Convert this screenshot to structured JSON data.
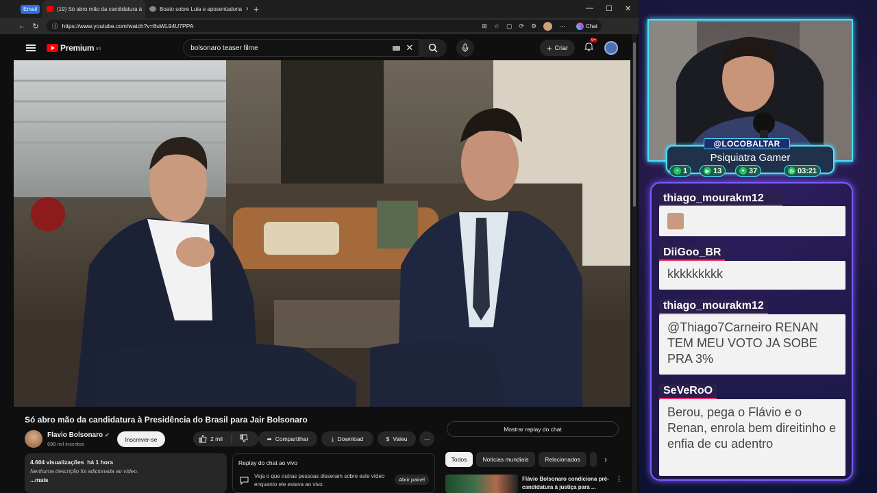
{
  "browser": {
    "tab_badge": "Email",
    "tabs": [
      {
        "label": "(19) Só abro mão da candidatura à",
        "active": true
      },
      {
        "label": "Boato sobre Lula e aposentadoria",
        "active": false
      }
    ],
    "url": "https://www.youtube.com/watch?v=8uWL94U7PPA",
    "chat_button": "Chat"
  },
  "youtube": {
    "logo_text": "Premium",
    "logo_region": "BR",
    "search_value": "bolsonaro teaser filme",
    "create_label": "Criar",
    "notification_count": "9+",
    "video_title": "Só abro mão da candidatura à Presidência do Brasil para Jair Bolsonaro",
    "channel_name": "Flavio Bolsonaro",
    "channel_subs": "698 mil inscritos",
    "subscribe_label": "Inscrever-se",
    "like_count": "2 mil",
    "share_label": "Compartilhar",
    "download_label": "Download",
    "thanks_label": "Valeu",
    "views": "4.604 visualizações",
    "posted": "há 1 hora",
    "description_empty": "Nenhuma descrição foi adicionada ao vídeo.",
    "more_label": "...mais",
    "replay_title": "Replay do chat ao vivo",
    "replay_text": "Veja o que outras pessoas disseram sobre este vídeo enquanto ele estava ao vivo.",
    "replay_open": "Abrir painel",
    "show_chat_replay": "Mostrar replay do chat",
    "chips": [
      "Todos",
      "Notícias mundiais",
      "Relacionados"
    ],
    "rec_title": "Flávio Bolsonaro condiciona pré-candidatura à justiça para ..."
  },
  "stream": {
    "handle": "@LOCOBALTAR",
    "subtitle": "Psiquiatra Gamer",
    "stats": [
      "1",
      "13",
      "37",
      "03:21"
    ]
  },
  "chat": [
    {
      "user": "thiago_mourakm12",
      "text": ""
    },
    {
      "user": "DiiGoo_BR",
      "text": "kkkkkkkkk"
    },
    {
      "user": "thiago_mourakm12",
      "text": "@Thiago7Carneiro RENAN TEM MEU VOTO JA SOBE PRA 3%"
    },
    {
      "user": "SeVeRoO",
      "text": "Berou, pega o Flávio e o Renan, enrola bem direitinho e enfia de cu adentro"
    }
  ],
  "colors": {
    "neon_cyan": "#49e1ff",
    "neon_purple": "#7a5cff",
    "yt_red": "#ff0000",
    "accent_pink": "#ff2f6d"
  }
}
